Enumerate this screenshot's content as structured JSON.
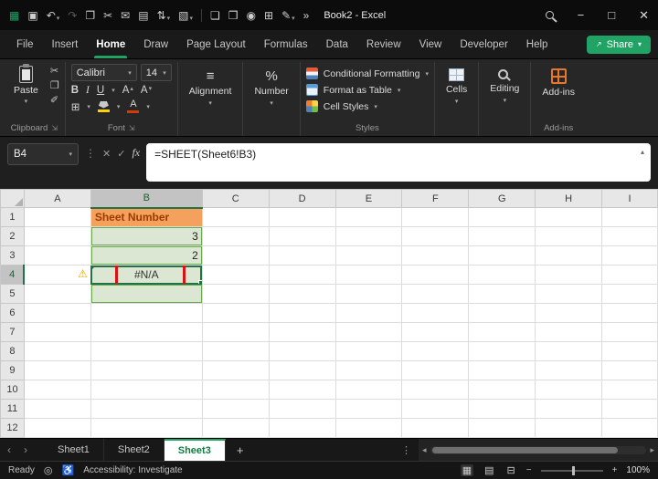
{
  "titlebar": {
    "title": "Book2 - Excel",
    "minimize": "−",
    "maximize": "□",
    "close": "✕",
    "qat": [
      {
        "name": "excel-app-icon",
        "glyph": "▦",
        "accent": true
      },
      {
        "name": "save-icon",
        "glyph": "▣"
      },
      {
        "name": "undo-icon",
        "glyph": "↶",
        "caret": true
      },
      {
        "name": "redo-icon",
        "glyph": "↷",
        "dim": true
      },
      {
        "name": "copy-icon",
        "glyph": "❐"
      },
      {
        "name": "cut-icon",
        "glyph": "✂"
      },
      {
        "name": "mail-icon",
        "glyph": "✉"
      },
      {
        "name": "chart-icon",
        "glyph": "▤"
      },
      {
        "name": "sort-icon",
        "glyph": "⇅",
        "caret": true
      },
      {
        "name": "fill-color-qat-icon",
        "glyph": "▧",
        "caret": true
      },
      {
        "name": "qat-divider",
        "divider": true
      },
      {
        "name": "new-doc-icon",
        "glyph": "❏"
      },
      {
        "name": "print-icon",
        "glyph": "❒"
      },
      {
        "name": "camera-icon",
        "glyph": "◉"
      },
      {
        "name": "table-icon",
        "glyph": "⊞"
      },
      {
        "name": "draw-icon",
        "glyph": "✎",
        "caret": true
      },
      {
        "name": "more-commands-icon",
        "glyph": "»"
      }
    ]
  },
  "menu": {
    "tabs": [
      {
        "label": "File"
      },
      {
        "label": "Insert"
      },
      {
        "label": "Home",
        "active": true
      },
      {
        "label": "Draw"
      },
      {
        "label": "Page Layout"
      },
      {
        "label": "Formulas"
      },
      {
        "label": "Data"
      },
      {
        "label": "Review"
      },
      {
        "label": "View"
      },
      {
        "label": "Developer"
      },
      {
        "label": "Help"
      }
    ],
    "share": {
      "label": "Share",
      "icon": "↗",
      "caret": "▾"
    }
  },
  "ribbon": {
    "caret": "▾",
    "caret_up": "▴",
    "launcher": "⇲",
    "clipboard": {
      "paste": "Paste",
      "cut": "✂",
      "copy": "❐",
      "format_painter": "✐",
      "label": "Clipboard"
    },
    "font": {
      "name": "Calibri",
      "size": "14",
      "bold": "B",
      "italic": "I",
      "underline": "U",
      "grow": "A",
      "shrink": "A",
      "borders": "⊞",
      "color_letter": "A",
      "label": "Font",
      "font_color_hex": "#d83b01",
      "fill_color_hex": "#ffd100"
    },
    "alignment": {
      "icon": "≡",
      "label": "Alignment"
    },
    "number": {
      "icon": "%",
      "label": "Number"
    },
    "styles": {
      "conditional": "Conditional Formatting",
      "format_table": "Format as Table",
      "cell_styles": "Cell Styles",
      "label": "Styles"
    },
    "cells": {
      "label": "Cells"
    },
    "editing": {
      "label": "Editing"
    },
    "addins": {
      "label": "Add-ins",
      "group_label": "Add-ins",
      "accent_hex": "#E8762B"
    }
  },
  "formula": {
    "name_box": "B4",
    "name_caret": "▾",
    "dots": "⋮",
    "cancel": "✕",
    "enter": "✓",
    "fx": "fx",
    "text": "=SHEET(Sheet6!B3)",
    "expand": "▴"
  },
  "grid": {
    "column_headers": [
      "A",
      "B",
      "C",
      "D",
      "E",
      "F",
      "G",
      "H",
      "I"
    ],
    "row_count": 12,
    "selected_column": "B",
    "selected_row": 4,
    "active_cell": "B4",
    "warning_cell": "A4",
    "warning_glyph": "⚠",
    "cells": [
      {
        "ref": "B1",
        "text": "Sheet Number",
        "classes": "orange"
      },
      {
        "ref": "B2",
        "text": "3",
        "classes": "green num"
      },
      {
        "ref": "B3",
        "text": "2",
        "classes": "green num"
      },
      {
        "ref": "B4",
        "text": "#N/A",
        "classes": "green error annotated"
      },
      {
        "ref": "B5",
        "text": "",
        "classes": "green"
      }
    ],
    "fill_orange_hex": "#F4A15D",
    "fill_green_hex": "#DBE7D3",
    "annotation_red_hex": "#DD1111"
  },
  "sheetbar": {
    "nav_left": "‹",
    "nav_right": "›",
    "add": "+",
    "more": "⋮",
    "scroll_left": "◂",
    "scroll_right": "▸",
    "tabs": [
      {
        "label": "Sheet1"
      },
      {
        "label": "Sheet2"
      },
      {
        "label": "Sheet3",
        "active": true
      }
    ]
  },
  "status": {
    "ready": "Ready",
    "macro_glyph": "◎",
    "accessibility_glyph": "♿",
    "accessibility": "Accessibility: Investigate",
    "view_icons": [
      {
        "name": "normal-view-icon",
        "glyph": "▦"
      },
      {
        "name": "page-layout-icon",
        "glyph": "▤"
      },
      {
        "name": "page-break-icon",
        "glyph": "⊟"
      }
    ],
    "zoom_out": "−",
    "zoom_in": "+",
    "zoom": "100%"
  }
}
